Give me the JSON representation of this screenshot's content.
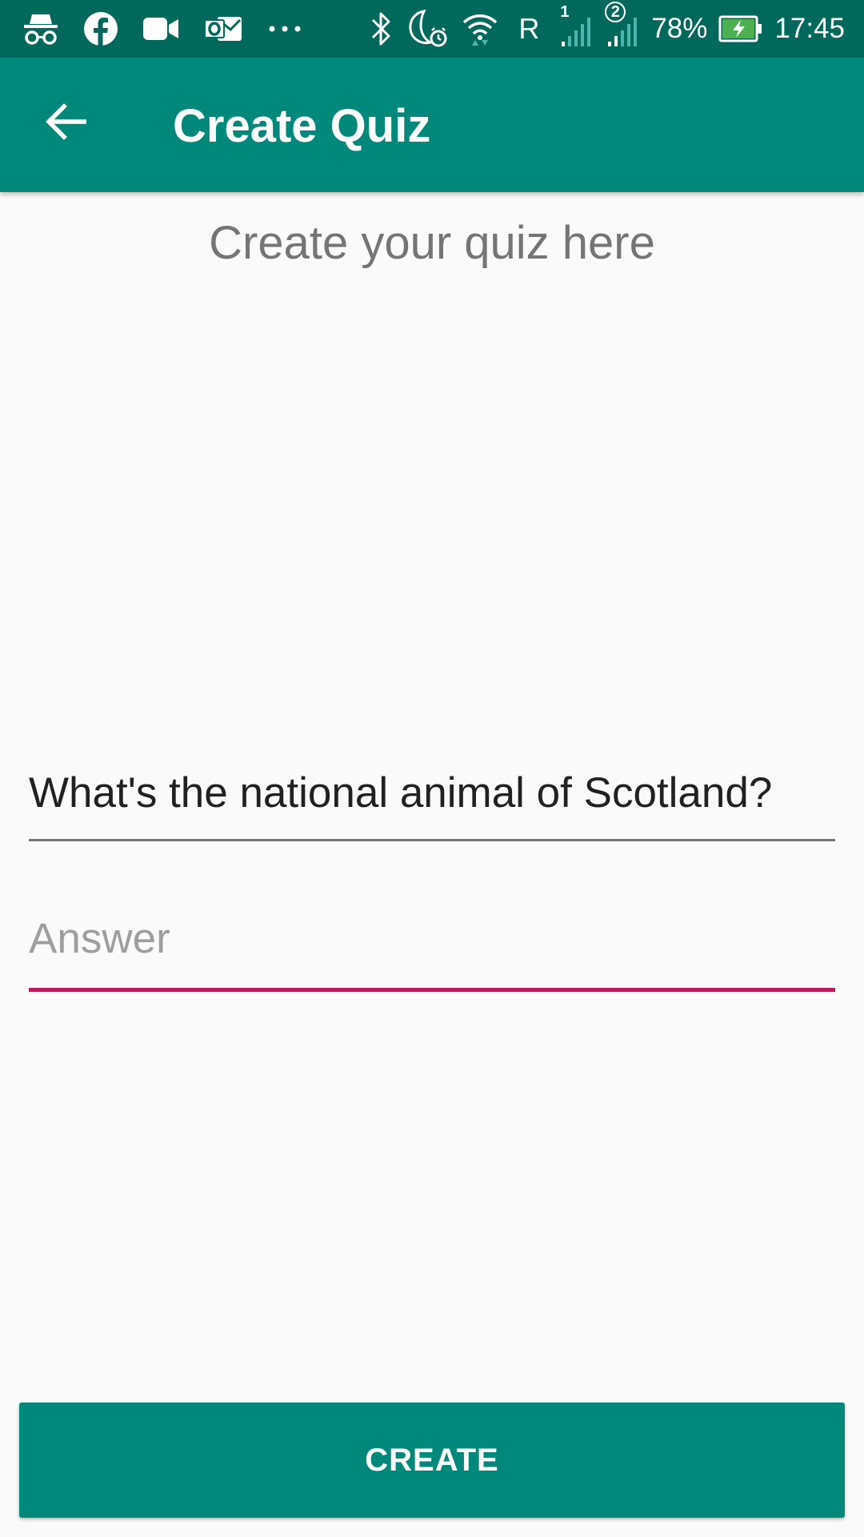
{
  "status_bar": {
    "icons_left": [
      "incognito-icon",
      "facebook-icon",
      "video-camera-icon",
      "outlook-icon",
      "more-dots-icon"
    ],
    "icons_right": [
      "bluetooth-icon",
      "moon-alarm-icon",
      "wifi-icon",
      "signal-sim1-icon",
      "signal-sim2-icon",
      "battery-charging-icon"
    ],
    "roaming": "R",
    "sim1_label": "1",
    "sim2_label": "2",
    "battery": "78%",
    "time": "17:45",
    "colors": {
      "background": "#00695c",
      "battery_fill": "#4caf50"
    }
  },
  "app_bar": {
    "title": "Create Quiz",
    "back_icon": "arrow-back-icon",
    "colors": {
      "background": "#00897b",
      "text": "#ffffff"
    }
  },
  "main": {
    "heading": "Create your quiz here",
    "question_field": {
      "value": "What's the national animal of Scotland?",
      "placeholder": ""
    },
    "answer_field": {
      "value": "",
      "placeholder": "Answer",
      "accent_color": "#c2185b"
    },
    "create_button": {
      "label": "CREATE",
      "color": "#00897b"
    }
  }
}
